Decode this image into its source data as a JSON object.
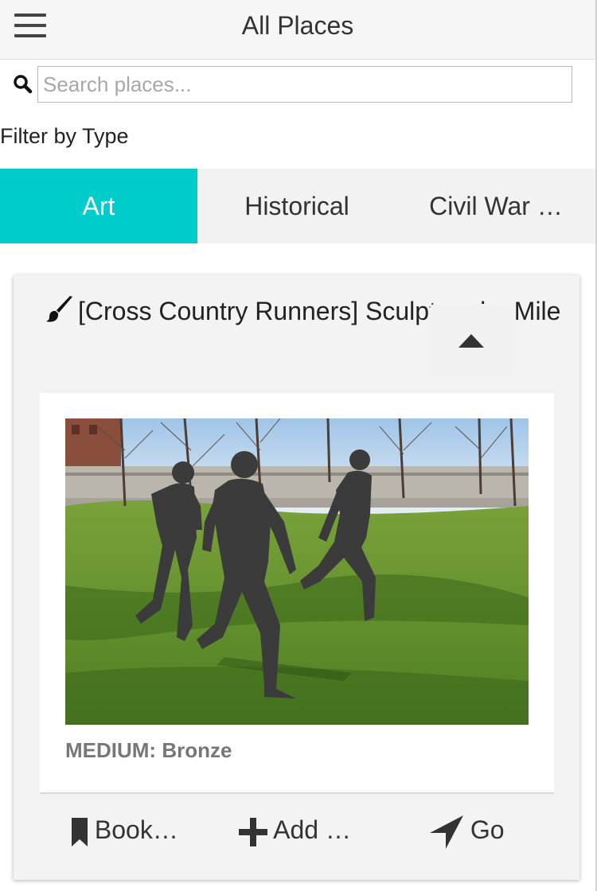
{
  "header": {
    "title": "All Places"
  },
  "search": {
    "placeholder": "Search places..."
  },
  "filter": {
    "label": "Filter by Type",
    "tabs": [
      {
        "label": "Art",
        "active": true
      },
      {
        "label": "Historical",
        "active": false
      },
      {
        "label": "Civil War …",
        "active": false
      }
    ]
  },
  "place_card": {
    "title": "[Cross Country Runners] Sculpture by Mile",
    "category_icon": "paintbrush-icon",
    "medium_label": "MEDIUM:",
    "medium_value": "Bronze",
    "actions": {
      "bookmark_label": "Book…",
      "add_label": "Add …",
      "go_label": "Go"
    }
  },
  "colors": {
    "accent": "#00cccc",
    "header_bg": "#f6f6f6",
    "card_bg": "#f3f3f3"
  }
}
